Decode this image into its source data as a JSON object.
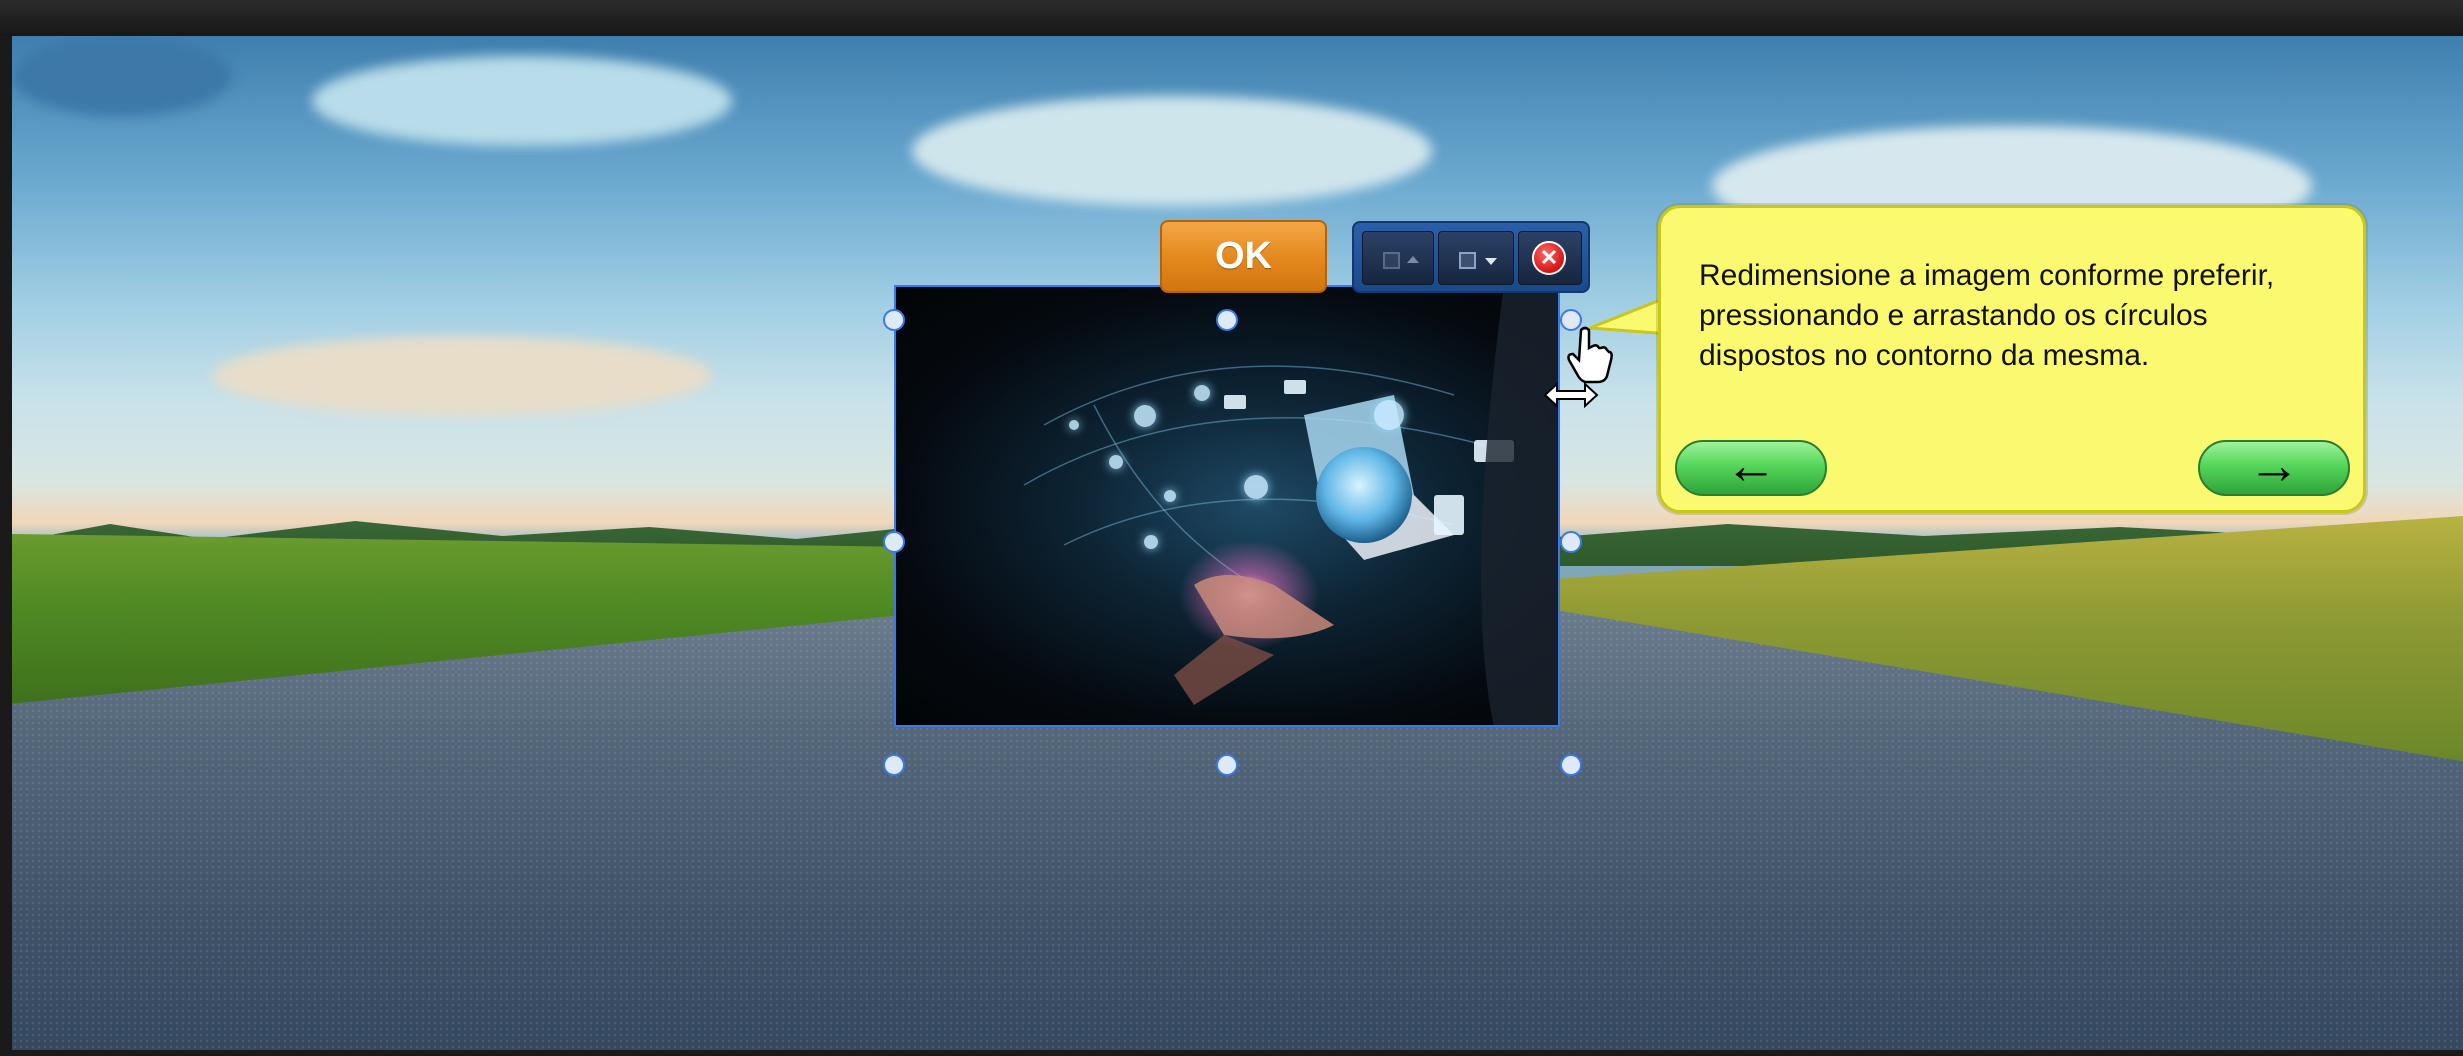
{
  "editor": {
    "ok_button_label": "OK",
    "toolbar": {
      "send_backward_icon": "layer-backward-icon",
      "bring_forward_icon": "layer-forward-icon",
      "close_icon": "close-icon"
    }
  },
  "tooltip": {
    "text": "Redimensione a imagem conforme preferir, pressionando e arrastando os círculos dispostos no contorno da mesma.",
    "prev_icon": "arrow-left-icon",
    "next_icon": "arrow-right-icon"
  },
  "colors": {
    "ok_orange": "#e58a1e",
    "selection_blue": "#3a79e8",
    "tooltip_yellow": "#fbf96f",
    "nav_green": "#55d65a",
    "toolbar_blue": "#1a4a8c"
  }
}
